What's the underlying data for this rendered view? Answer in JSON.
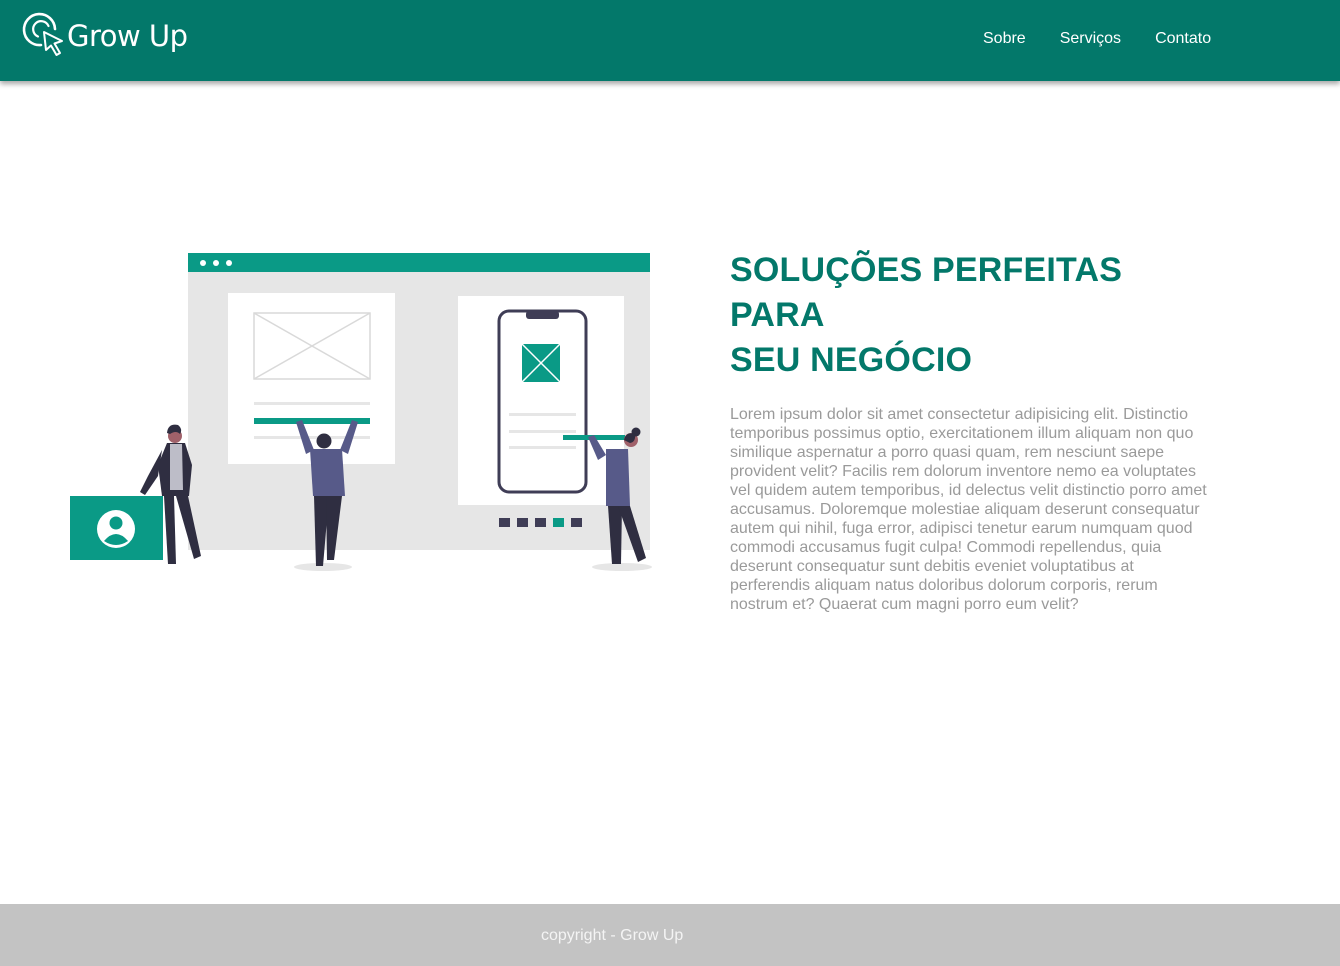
{
  "brand": {
    "name": "Grow Up",
    "color": "#03786a"
  },
  "nav": {
    "items": [
      {
        "label": "Sobre"
      },
      {
        "label": "Serviços"
      },
      {
        "label": "Contato"
      }
    ]
  },
  "hero": {
    "title_line1": "SOLUÇÕES PERFEITAS PARA",
    "title_line2": "SEU NEGÓCIO",
    "description": "Lorem ipsum dolor sit amet consectetur adipisicing elit. Distinctio temporibus possimus optio, exercitationem illum aliquam non quo similique aspernatur a porro quasi quam, rem nesciunt saepe provident velit? Facilis rem dolorum inventore nemo ea voluptates vel quidem autem temporibus, id delectus velit distinctio porro amet accusamus. Doloremque molestiae aliquam deserunt consequatur autem qui nihil, fuga error, adipisci tenetur earum numquam quod commodi accusamus fugit culpa! Commodi repellendus, quia deserunt consequatur sunt debitis eveniet voluptatibus at perferendis aliquam natus doloribus dolorum corporis, rerum nostrum et? Quaerat cum magni porro eum velit?"
  },
  "footer": {
    "text": "copyright - Grow Up"
  }
}
